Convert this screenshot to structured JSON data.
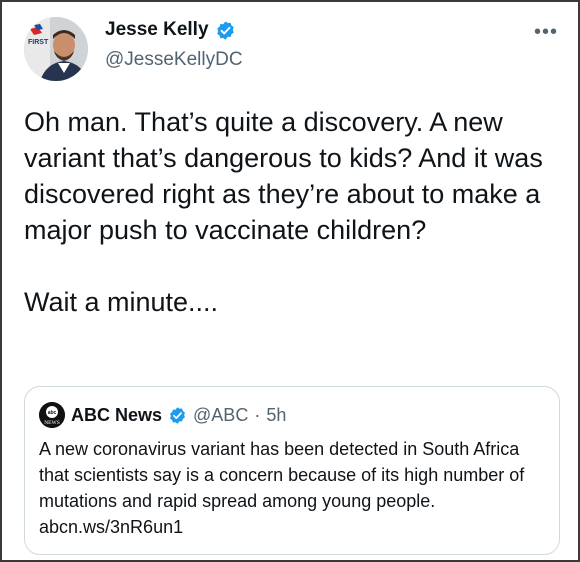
{
  "tweet": {
    "author": {
      "display_name": "Jesse Kelly",
      "handle": "@JesseKellyDC",
      "avatar_badge_text": "FIRST",
      "verified": true
    },
    "more_icon": "ellipsis-icon",
    "text": "Oh man. That’s quite a discovery. A new variant that’s dangerous to kids? And it was discovered right as they’re about to make a major push to vaccinate children?\n\nWait a minute....",
    "quoted_tweet": {
      "display_name": "ABC News",
      "handle": "@ABC",
      "separator": "·",
      "time": "5h",
      "verified": true,
      "avatar_text": "NEWS",
      "text": "A new coronavirus variant has been detected in South Africa that scientists say is a concern because of its high number of mutations and rapid spread among young people. abcn.ws/3nR6un1"
    }
  },
  "colors": {
    "verified_blue": "#1d9bf0",
    "secondary_text": "#536471",
    "primary_text": "#0f1419",
    "border": "#cfd9de"
  }
}
